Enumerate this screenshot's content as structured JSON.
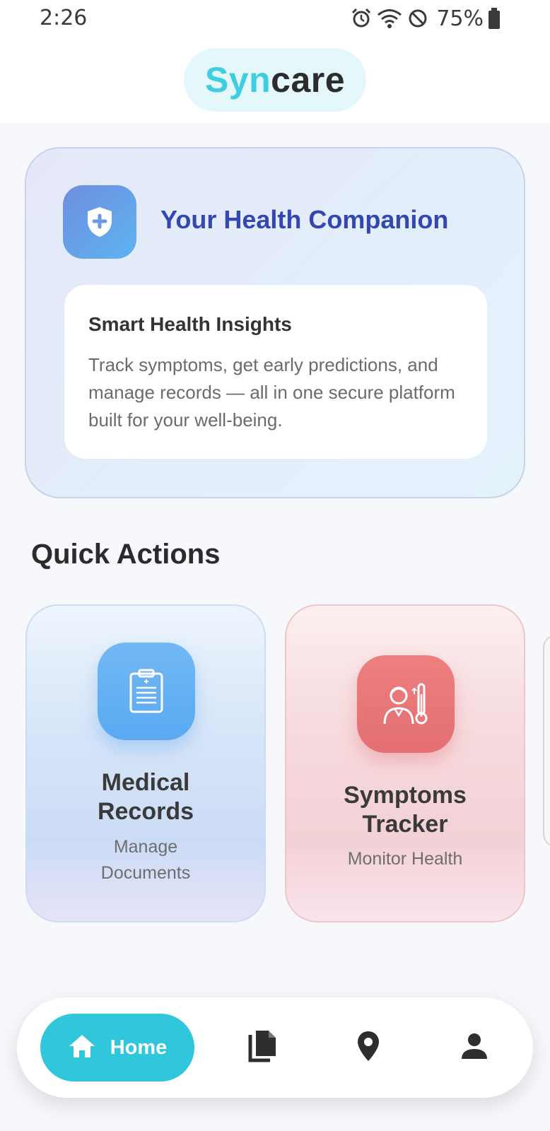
{
  "status_bar": {
    "time": "2:26",
    "battery": "75%",
    "icons": [
      "alarm-icon",
      "wifi-icon",
      "do-not-disturb-icon",
      "battery-icon"
    ]
  },
  "header": {
    "logo_part1": "Syn",
    "logo_part2": "care"
  },
  "hero": {
    "icon": "shield-plus-icon",
    "title": "Your Health Companion",
    "insight_title": "Smart Health Insights",
    "insight_body": "Track symptoms, get early predictions, and manage records — all in one secure platform built for your well-being."
  },
  "quick_actions": {
    "title": "Quick Actions",
    "cards": [
      {
        "icon": "clipboard-icon",
        "title_line1": "Medical",
        "title_line2": "Records",
        "subtitle_line1": "Manage",
        "subtitle_line2": "Documents",
        "color": "#5aa9f2"
      },
      {
        "icon": "patient-thermometer-icon",
        "title_line1": "Symptoms",
        "title_line2": "Tracker",
        "subtitle": "Monitor Health",
        "color": "#e36f72"
      }
    ]
  },
  "bottom_nav": {
    "items": [
      {
        "icon": "home-icon",
        "label": "Home",
        "active": true
      },
      {
        "icon": "documents-icon"
      },
      {
        "icon": "location-pin-icon"
      },
      {
        "icon": "person-icon"
      }
    ],
    "accent": "#30c7dc"
  }
}
